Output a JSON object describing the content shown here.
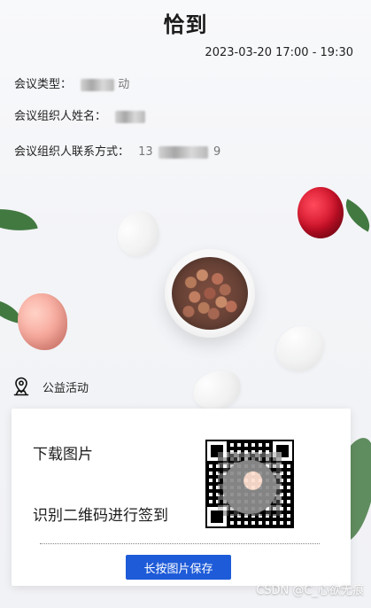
{
  "header": {
    "title": "恰到",
    "datetime": "2023-03-20  17:00 - 19:30"
  },
  "info": {
    "type_label": "会议类型：",
    "type_value_visible_suffix": "动",
    "organizer_name_label": "会议组织人姓名：",
    "organizer_contact_label": "会议组织人联系方式：",
    "organizer_contact_visible_prefix": "13",
    "organizer_contact_visible_suffix": "9"
  },
  "activity": {
    "icon": "map-pin-person-icon",
    "label": "公益活动"
  },
  "card": {
    "line1": "下载图片",
    "line2": "识别二维码进行签到",
    "button_label": "长按图片保存",
    "button_color": "#1e5bd8"
  },
  "watermark": {
    "text": "CSDN @C_心欲无痕"
  }
}
